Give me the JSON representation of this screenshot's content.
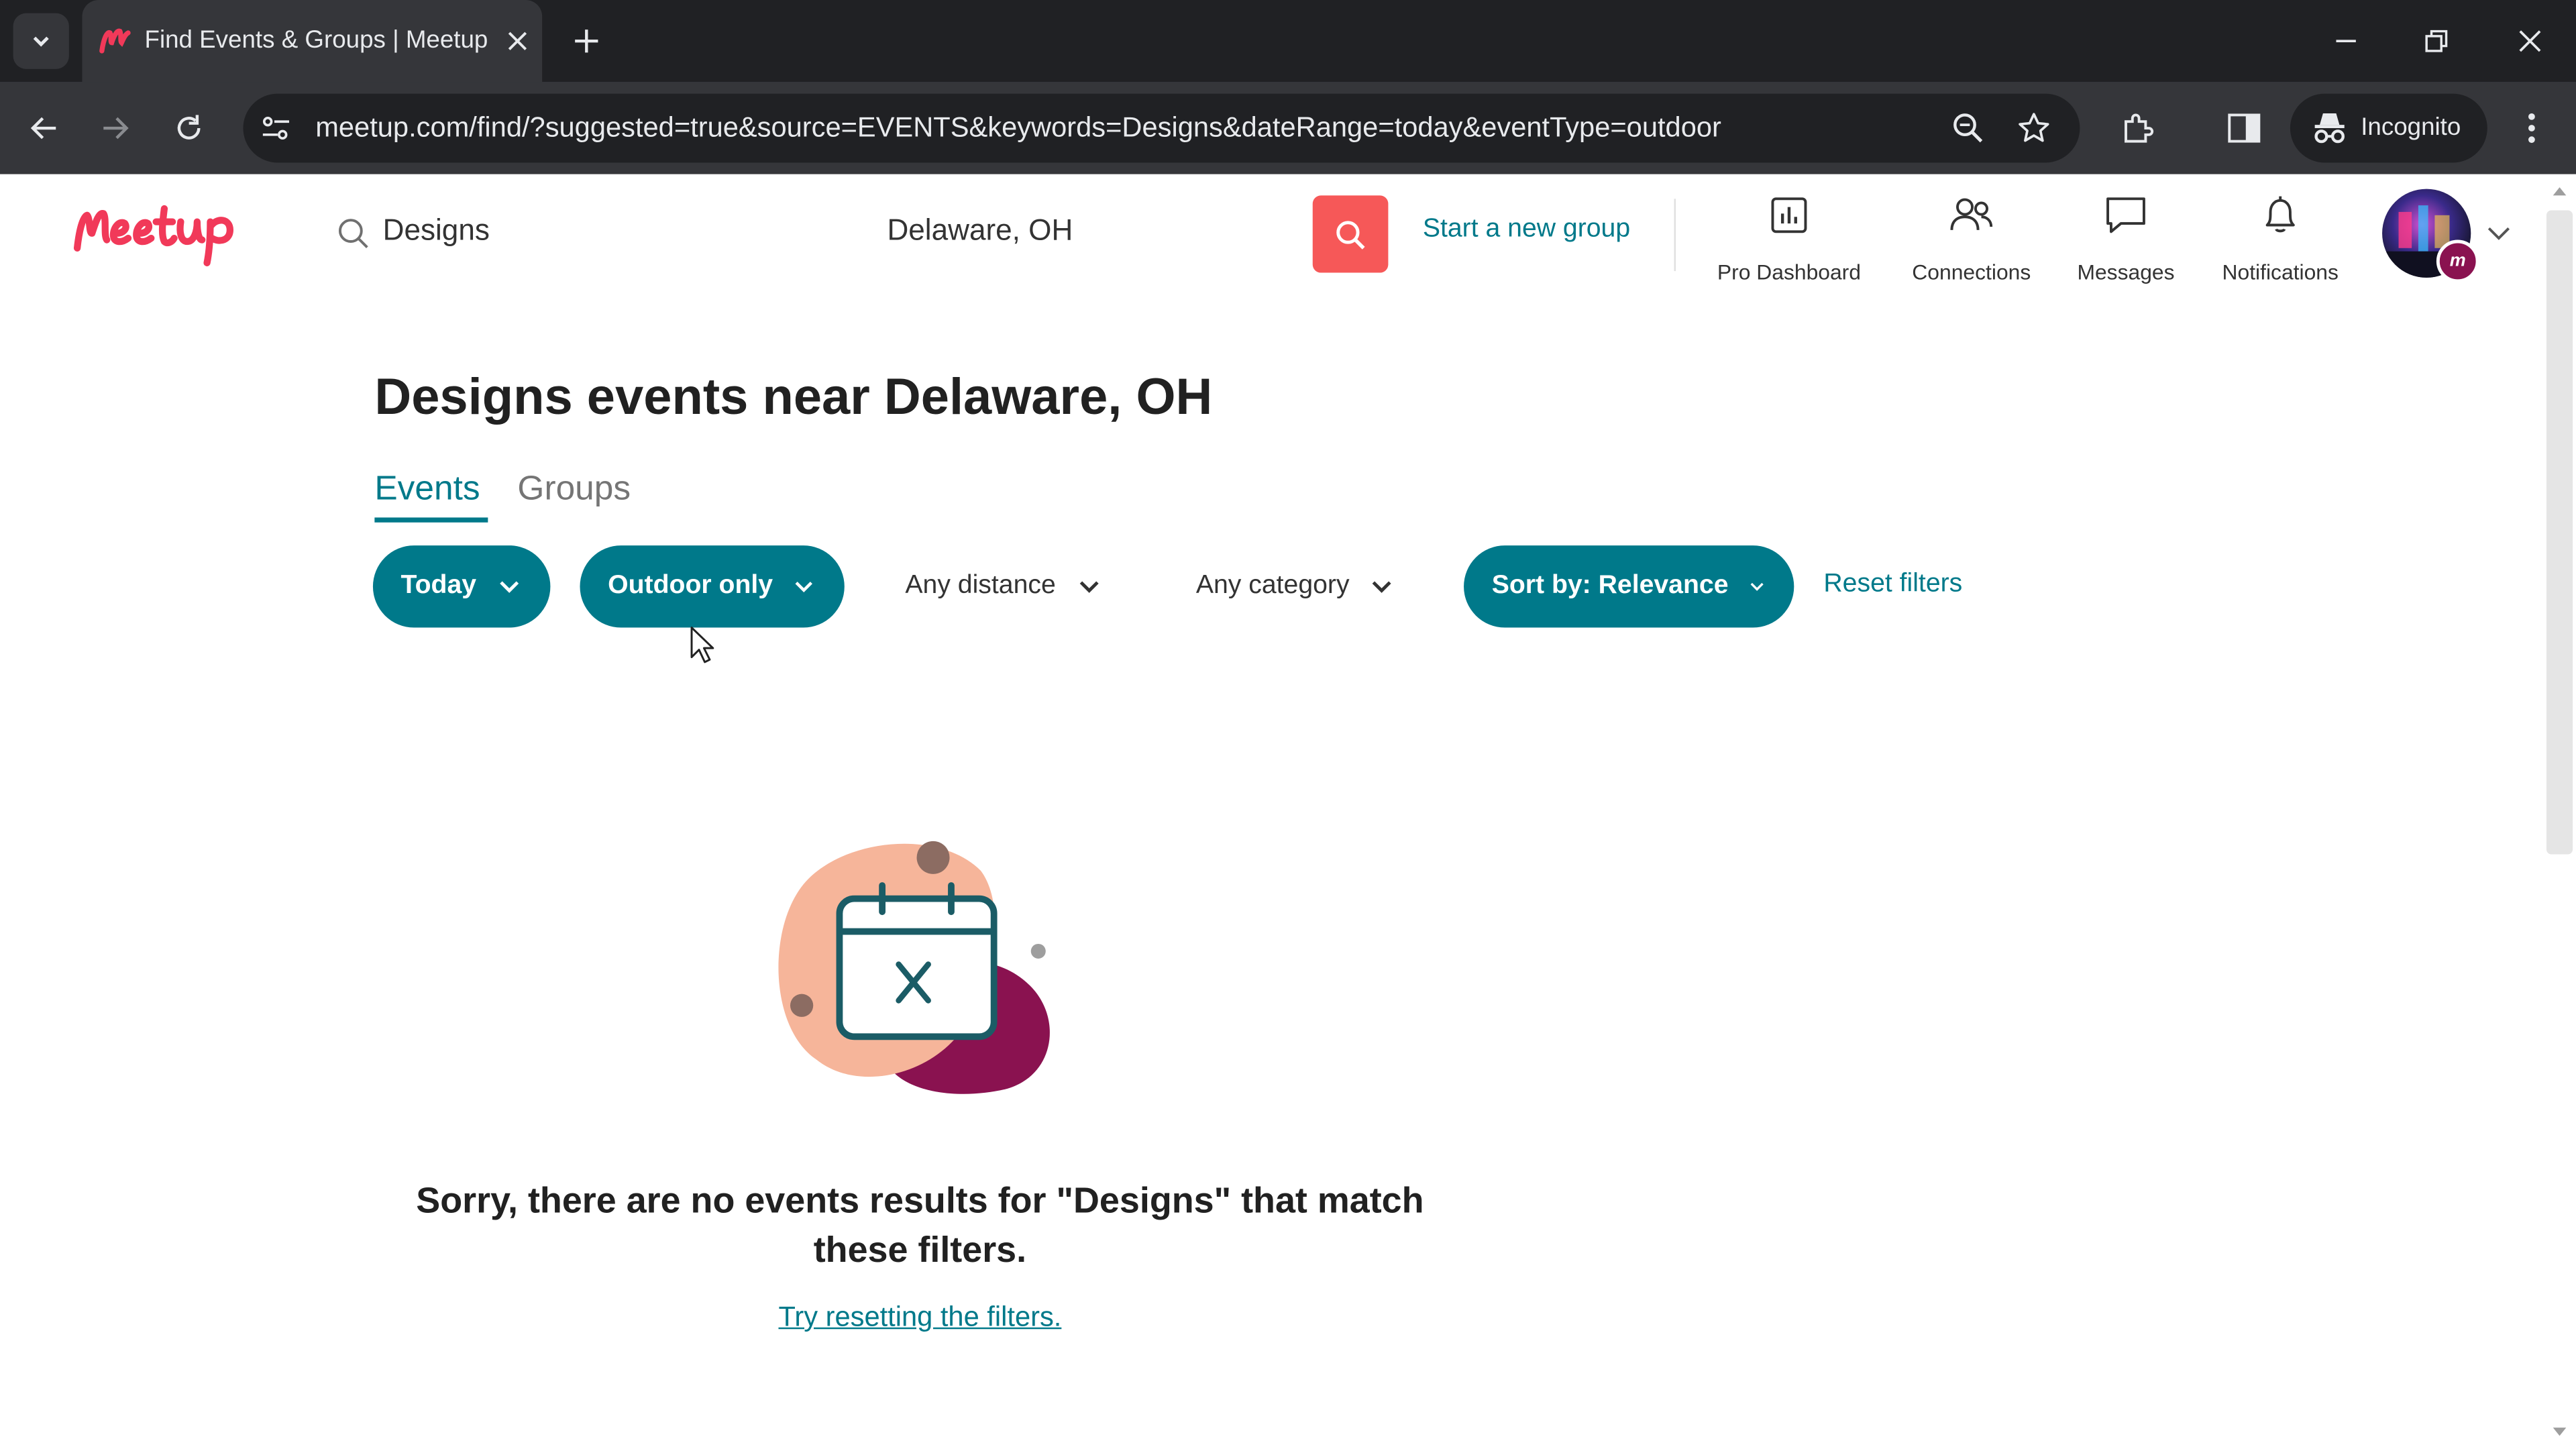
{
  "browser": {
    "tab_title": "Find Events & Groups | Meetup",
    "url": "meetup.com/find/?suggested=true&source=EVENTS&keywords=Designs&dateRange=today&eventType=outdoor",
    "profile_label": "Incognito"
  },
  "header": {
    "search_keyword": "Designs",
    "location": "Delaware, OH",
    "start_group_label": "Start a new group",
    "nav": [
      {
        "label": "Pro Dashboard",
        "icon": "bar-chart-icon"
      },
      {
        "label": "Connections",
        "icon": "people-icon"
      },
      {
        "label": "Messages",
        "icon": "chat-icon"
      },
      {
        "label": "Notifications",
        "icon": "bell-icon"
      }
    ],
    "avatar_badge": "m"
  },
  "main": {
    "title": "Designs events near Delaware, OH",
    "tabs": [
      {
        "label": "Events",
        "active": true
      },
      {
        "label": "Groups",
        "active": false
      }
    ],
    "filters": [
      {
        "label": "Today",
        "style": "filled"
      },
      {
        "label": "Outdoor only",
        "style": "filled"
      },
      {
        "label": "Any distance",
        "style": "plain"
      },
      {
        "label": "Any category",
        "style": "plain"
      },
      {
        "label": "Sort by: Relevance",
        "style": "filled"
      }
    ],
    "reset_label": "Reset filters",
    "empty_message": "Sorry, there are no events results for \"Designs\" that match these filters.",
    "try_reset_label": "Try resetting the filters."
  },
  "colors": {
    "brand_teal": "#00798a",
    "search_red": "#f65858",
    "logo_pink": "#f13959"
  }
}
